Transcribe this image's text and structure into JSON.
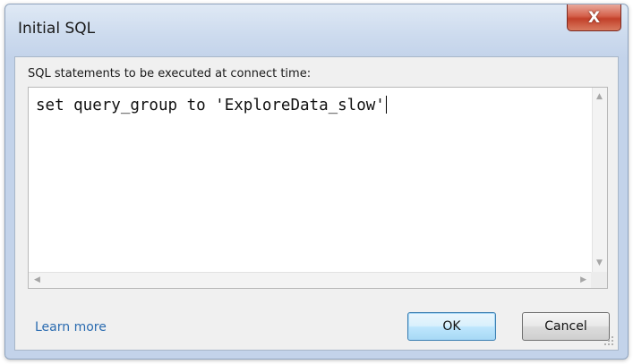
{
  "window": {
    "title": "Initial SQL",
    "close_glyph": "X"
  },
  "prompt": {
    "label": "SQL statements to be executed at connect time:"
  },
  "editor": {
    "value": "set query_group to 'ExploreData_slow'",
    "up_arrow": "▲",
    "down_arrow": "▼",
    "left_arrow": "◀",
    "right_arrow": "▶"
  },
  "footer": {
    "learn_more": "Learn more",
    "ok_label": "OK",
    "cancel_label": "Cancel"
  },
  "colors": {
    "link": "#2a6bb0",
    "close_button": "#c2402a",
    "default_button": "#bee6fd"
  }
}
